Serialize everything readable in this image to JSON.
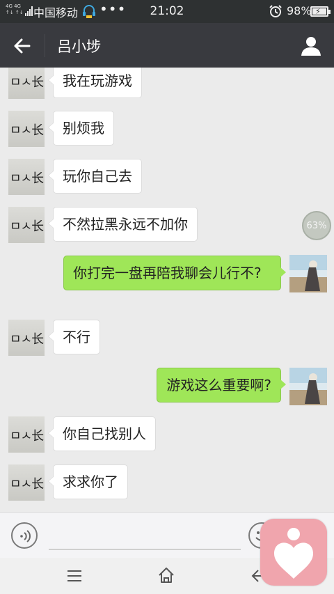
{
  "status_bar": {
    "network": "4G 4G",
    "carrier": "中国移动",
    "more": "•••",
    "time": "21:02",
    "battery": "98%"
  },
  "header": {
    "title": "吕小埗"
  },
  "messages": [
    {
      "side": "left",
      "text": "我在玩游戏"
    },
    {
      "side": "left",
      "text": "别烦我"
    },
    {
      "side": "left",
      "text": "玩你自己去"
    },
    {
      "side": "left",
      "text": "不然拉黑永远不加你"
    },
    {
      "side": "right",
      "text": "你打完一盘再陪我聊会儿行不?"
    },
    {
      "side": "left",
      "text": "不行"
    },
    {
      "side": "right",
      "text": "游戏这么重要啊?"
    },
    {
      "side": "left",
      "text": "你自己找别人"
    },
    {
      "side": "left",
      "text": "求求你了"
    }
  ],
  "badge": {
    "progress_text": "63%",
    "progress": 0.63
  },
  "input": {
    "placeholder": "",
    "value": ""
  },
  "colors": {
    "titlebar": "#393a3f",
    "chat_bg": "#ebebeb",
    "outgoing_bubble": "#9fe658",
    "incoming_bubble": "#ffffff",
    "float_app": "#f0a5ad"
  },
  "icons": [
    "back-arrow-icon",
    "person-icon",
    "voice-icon",
    "emoji-icon",
    "menu-icon",
    "home-icon",
    "nav-back-icon",
    "heart-icon",
    "alarm-icon",
    "headset-icon"
  ]
}
